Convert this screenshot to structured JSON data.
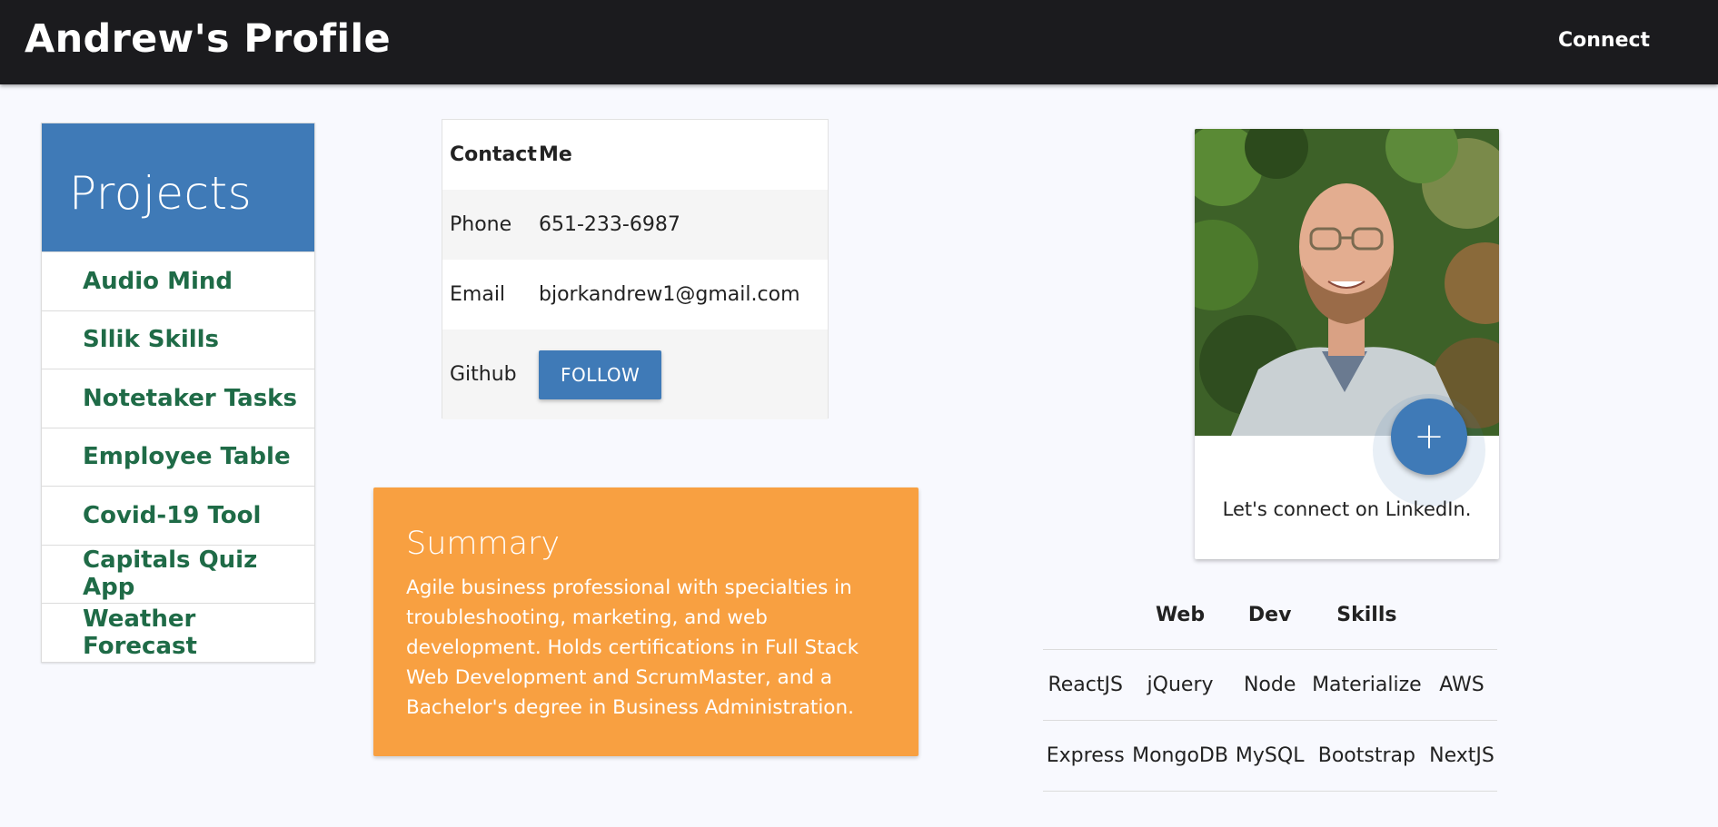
{
  "header": {
    "title": "Andrew's Profile",
    "nav_link": "Connect"
  },
  "projects": {
    "title": "Projects",
    "items": [
      {
        "label": "Audio Mind"
      },
      {
        "label": "Sllik Skills"
      },
      {
        "label": "Notetaker Tasks"
      },
      {
        "label": "Employee Table"
      },
      {
        "label": "Covid-19 Tool"
      },
      {
        "label": "Capitals Quiz App"
      },
      {
        "label": "Weather Forecast"
      }
    ]
  },
  "contact": {
    "header": [
      "Contact",
      "Me"
    ],
    "phone_label": "Phone",
    "phone_value": "651-233-6987",
    "email_label": "Email",
    "email_value": "bjorkandrew1@gmail.com",
    "github_label": "Github",
    "follow_button": "FOLLOW"
  },
  "summary": {
    "title": "Summary",
    "text": "Agile business professional with specialties in troubleshooting, marketing, and web development. Holds certifications in Full Stack Web Development and ScrumMaster, and a Bachelor's degree in Business Administration."
  },
  "profile_card": {
    "fab_icon": "plus-icon",
    "fab_glyph": "+",
    "caption": "Let's connect on LinkedIn."
  },
  "skills": {
    "headers": [
      "",
      "Web",
      "Dev",
      "Skills",
      ""
    ],
    "rows": [
      [
        "ReactJS",
        "jQuery",
        "Node",
        "Materialize",
        "AWS"
      ],
      [
        "Express",
        "MongoDB",
        "MySQL",
        "Bootstrap",
        "NextJS"
      ]
    ]
  },
  "colors": {
    "navbar": "#1b1b1e",
    "primary_blue": "#3f7ab7",
    "project_link": "#1f6b47",
    "summary_orange": "#f8a041",
    "background": "#f8f9fe"
  }
}
